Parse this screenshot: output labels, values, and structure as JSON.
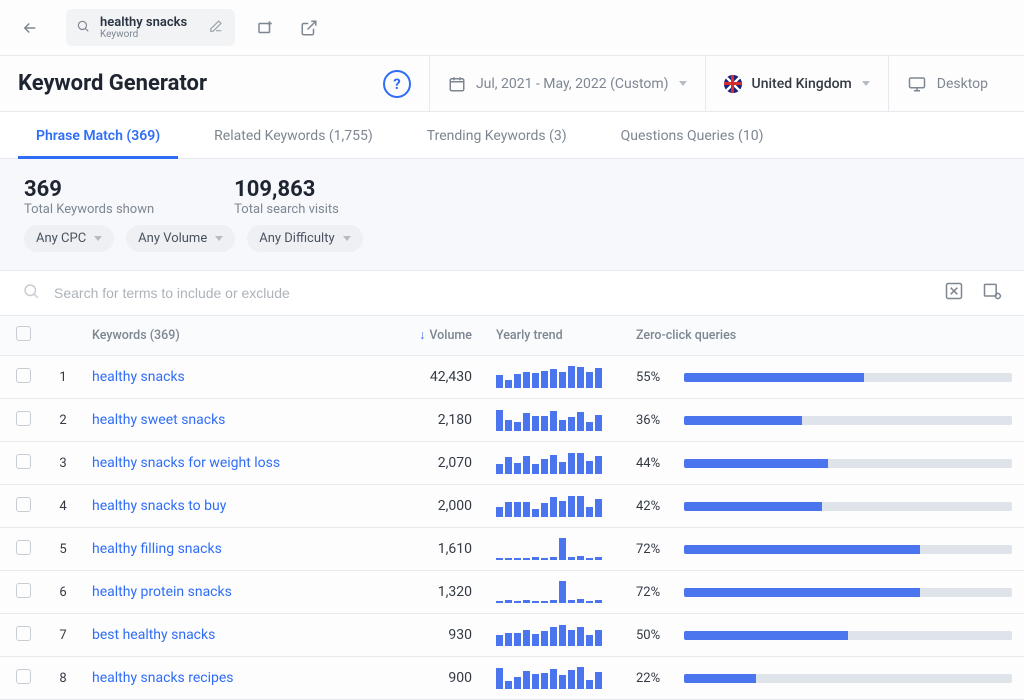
{
  "topbar": {
    "keyword": "healthy snacks",
    "keyword_type": "Keyword"
  },
  "header": {
    "title": "Keyword Generator",
    "date_range": "Jul, 2021 - May, 2022 (Custom)",
    "country": "United Kingdom",
    "device": "Desktop"
  },
  "tabs": [
    {
      "label": "Phrase Match (369)",
      "active": true
    },
    {
      "label": "Related Keywords (1,755)",
      "active": false
    },
    {
      "label": "Trending Keywords (3)",
      "active": false
    },
    {
      "label": "Questions Queries (10)",
      "active": false
    }
  ],
  "summary": {
    "total_keywords_value": "369",
    "total_keywords_label": "Total Keywords shown",
    "total_visits_value": "109,863",
    "total_visits_label": "Total search visits"
  },
  "filters": {
    "cpc": "Any CPC",
    "volume": "Any Volume",
    "difficulty": "Any Difficulty"
  },
  "search": {
    "placeholder": "Search for terms to include or exclude"
  },
  "columns": {
    "keywords": "Keywords (369)",
    "volume": "Volume",
    "trend": "Yearly trend",
    "zcq": "Zero-click queries"
  },
  "rows": [
    {
      "idx": "1",
      "keyword": "healthy snacks",
      "volume": "42,430",
      "trend": [
        60,
        38,
        64,
        74,
        70,
        78,
        86,
        72,
        98,
        94,
        74,
        92
      ],
      "zcq_pct": "55%",
      "zcq": 55
    },
    {
      "idx": "2",
      "keyword": "healthy sweet snacks",
      "volume": "2,180",
      "trend": [
        94,
        48,
        40,
        80,
        66,
        70,
        92,
        50,
        62,
        88,
        40,
        74
      ],
      "zcq_pct": "36%",
      "zcq": 36
    },
    {
      "idx": "3",
      "keyword": "healthy snacks for weight loss",
      "volume": "2,070",
      "trend": [
        44,
        78,
        52,
        84,
        44,
        66,
        88,
        56,
        96,
        94,
        60,
        84
      ],
      "zcq_pct": "44%",
      "zcq": 44
    },
    {
      "idx": "4",
      "keyword": "healthy snacks to buy",
      "volume": "2,000",
      "trend": [
        44,
        68,
        68,
        66,
        36,
        62,
        92,
        72,
        96,
        96,
        46,
        82
      ],
      "zcq_pct": "42%",
      "zcq": 42
    },
    {
      "idx": "5",
      "keyword": "healthy filling snacks",
      "volume": "1,610",
      "trend": [
        8,
        10,
        10,
        10,
        12,
        10,
        12,
        98,
        12,
        16,
        10,
        12
      ],
      "zcq_pct": "72%",
      "zcq": 72
    },
    {
      "idx": "6",
      "keyword": "healthy protein snacks",
      "volume": "1,320",
      "trend": [
        10,
        12,
        10,
        12,
        10,
        10,
        12,
        98,
        14,
        16,
        10,
        12
      ],
      "zcq_pct": "72%",
      "zcq": 72
    },
    {
      "idx": "7",
      "keyword": "best healthy snacks",
      "volume": "930",
      "trend": [
        50,
        60,
        58,
        72,
        54,
        70,
        86,
        96,
        72,
        86,
        48,
        72
      ],
      "zcq_pct": "50%",
      "zcq": 50
    },
    {
      "idx": "8",
      "keyword": "healthy snacks recipes",
      "volume": "900",
      "trend": [
        96,
        36,
        56,
        84,
        68,
        72,
        90,
        62,
        88,
        98,
        40,
        78
      ],
      "zcq_pct": "22%",
      "zcq": 22
    }
  ]
}
